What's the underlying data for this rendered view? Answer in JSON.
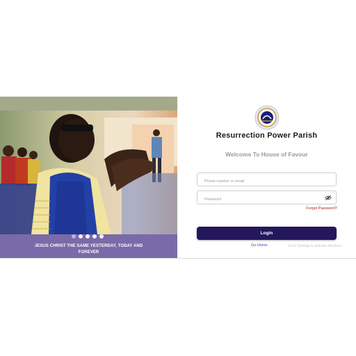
{
  "hero": {
    "caption": "JESUS CHRIST THE SAME YESTERDAY, TODAY AND FOREVER",
    "dots": 5
  },
  "brand": {
    "org_name": "Resurrection Power Parish",
    "welcome": "Welcome To House of Favour",
    "logo_icon": "rccg-logo",
    "accent": "#24175c",
    "caption_band": "#7b6aa9"
  },
  "form": {
    "phone_placeholder": "Phone number or email",
    "password_placeholder": "Password",
    "forgot_label": "Forgot Password?",
    "login_label": "Login",
    "go_home_label": "Go Home"
  },
  "system": {
    "watermark": "Go to Settings to activate Windows."
  }
}
